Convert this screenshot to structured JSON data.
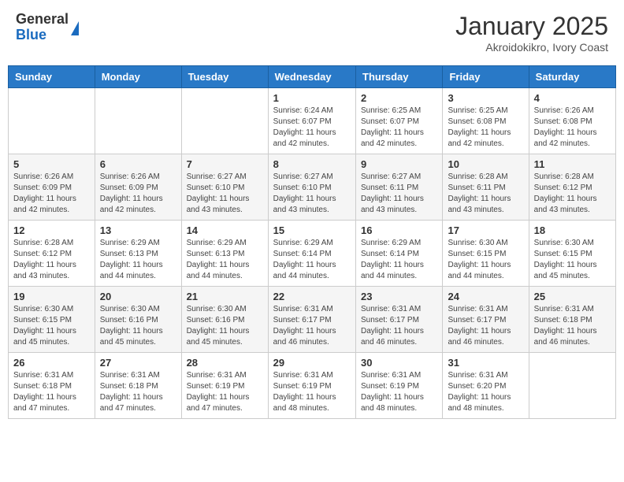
{
  "header": {
    "logo_general": "General",
    "logo_blue": "Blue",
    "month_title": "January 2025",
    "subtitle": "Akroidokikro, Ivory Coast"
  },
  "weekdays": [
    "Sunday",
    "Monday",
    "Tuesday",
    "Wednesday",
    "Thursday",
    "Friday",
    "Saturday"
  ],
  "weeks": [
    [
      {
        "day": "",
        "info": ""
      },
      {
        "day": "",
        "info": ""
      },
      {
        "day": "",
        "info": ""
      },
      {
        "day": "1",
        "info": "Sunrise: 6:24 AM\nSunset: 6:07 PM\nDaylight: 11 hours and 42 minutes."
      },
      {
        "day": "2",
        "info": "Sunrise: 6:25 AM\nSunset: 6:07 PM\nDaylight: 11 hours and 42 minutes."
      },
      {
        "day": "3",
        "info": "Sunrise: 6:25 AM\nSunset: 6:08 PM\nDaylight: 11 hours and 42 minutes."
      },
      {
        "day": "4",
        "info": "Sunrise: 6:26 AM\nSunset: 6:08 PM\nDaylight: 11 hours and 42 minutes."
      }
    ],
    [
      {
        "day": "5",
        "info": "Sunrise: 6:26 AM\nSunset: 6:09 PM\nDaylight: 11 hours and 42 minutes."
      },
      {
        "day": "6",
        "info": "Sunrise: 6:26 AM\nSunset: 6:09 PM\nDaylight: 11 hours and 42 minutes."
      },
      {
        "day": "7",
        "info": "Sunrise: 6:27 AM\nSunset: 6:10 PM\nDaylight: 11 hours and 43 minutes."
      },
      {
        "day": "8",
        "info": "Sunrise: 6:27 AM\nSunset: 6:10 PM\nDaylight: 11 hours and 43 minutes."
      },
      {
        "day": "9",
        "info": "Sunrise: 6:27 AM\nSunset: 6:11 PM\nDaylight: 11 hours and 43 minutes."
      },
      {
        "day": "10",
        "info": "Sunrise: 6:28 AM\nSunset: 6:11 PM\nDaylight: 11 hours and 43 minutes."
      },
      {
        "day": "11",
        "info": "Sunrise: 6:28 AM\nSunset: 6:12 PM\nDaylight: 11 hours and 43 minutes."
      }
    ],
    [
      {
        "day": "12",
        "info": "Sunrise: 6:28 AM\nSunset: 6:12 PM\nDaylight: 11 hours and 43 minutes."
      },
      {
        "day": "13",
        "info": "Sunrise: 6:29 AM\nSunset: 6:13 PM\nDaylight: 11 hours and 44 minutes."
      },
      {
        "day": "14",
        "info": "Sunrise: 6:29 AM\nSunset: 6:13 PM\nDaylight: 11 hours and 44 minutes."
      },
      {
        "day": "15",
        "info": "Sunrise: 6:29 AM\nSunset: 6:14 PM\nDaylight: 11 hours and 44 minutes."
      },
      {
        "day": "16",
        "info": "Sunrise: 6:29 AM\nSunset: 6:14 PM\nDaylight: 11 hours and 44 minutes."
      },
      {
        "day": "17",
        "info": "Sunrise: 6:30 AM\nSunset: 6:15 PM\nDaylight: 11 hours and 44 minutes."
      },
      {
        "day": "18",
        "info": "Sunrise: 6:30 AM\nSunset: 6:15 PM\nDaylight: 11 hours and 45 minutes."
      }
    ],
    [
      {
        "day": "19",
        "info": "Sunrise: 6:30 AM\nSunset: 6:15 PM\nDaylight: 11 hours and 45 minutes."
      },
      {
        "day": "20",
        "info": "Sunrise: 6:30 AM\nSunset: 6:16 PM\nDaylight: 11 hours and 45 minutes."
      },
      {
        "day": "21",
        "info": "Sunrise: 6:30 AM\nSunset: 6:16 PM\nDaylight: 11 hours and 45 minutes."
      },
      {
        "day": "22",
        "info": "Sunrise: 6:31 AM\nSunset: 6:17 PM\nDaylight: 11 hours and 46 minutes."
      },
      {
        "day": "23",
        "info": "Sunrise: 6:31 AM\nSunset: 6:17 PM\nDaylight: 11 hours and 46 minutes."
      },
      {
        "day": "24",
        "info": "Sunrise: 6:31 AM\nSunset: 6:17 PM\nDaylight: 11 hours and 46 minutes."
      },
      {
        "day": "25",
        "info": "Sunrise: 6:31 AM\nSunset: 6:18 PM\nDaylight: 11 hours and 46 minutes."
      }
    ],
    [
      {
        "day": "26",
        "info": "Sunrise: 6:31 AM\nSunset: 6:18 PM\nDaylight: 11 hours and 47 minutes."
      },
      {
        "day": "27",
        "info": "Sunrise: 6:31 AM\nSunset: 6:18 PM\nDaylight: 11 hours and 47 minutes."
      },
      {
        "day": "28",
        "info": "Sunrise: 6:31 AM\nSunset: 6:19 PM\nDaylight: 11 hours and 47 minutes."
      },
      {
        "day": "29",
        "info": "Sunrise: 6:31 AM\nSunset: 6:19 PM\nDaylight: 11 hours and 48 minutes."
      },
      {
        "day": "30",
        "info": "Sunrise: 6:31 AM\nSunset: 6:19 PM\nDaylight: 11 hours and 48 minutes."
      },
      {
        "day": "31",
        "info": "Sunrise: 6:31 AM\nSunset: 6:20 PM\nDaylight: 11 hours and 48 minutes."
      },
      {
        "day": "",
        "info": ""
      }
    ]
  ]
}
